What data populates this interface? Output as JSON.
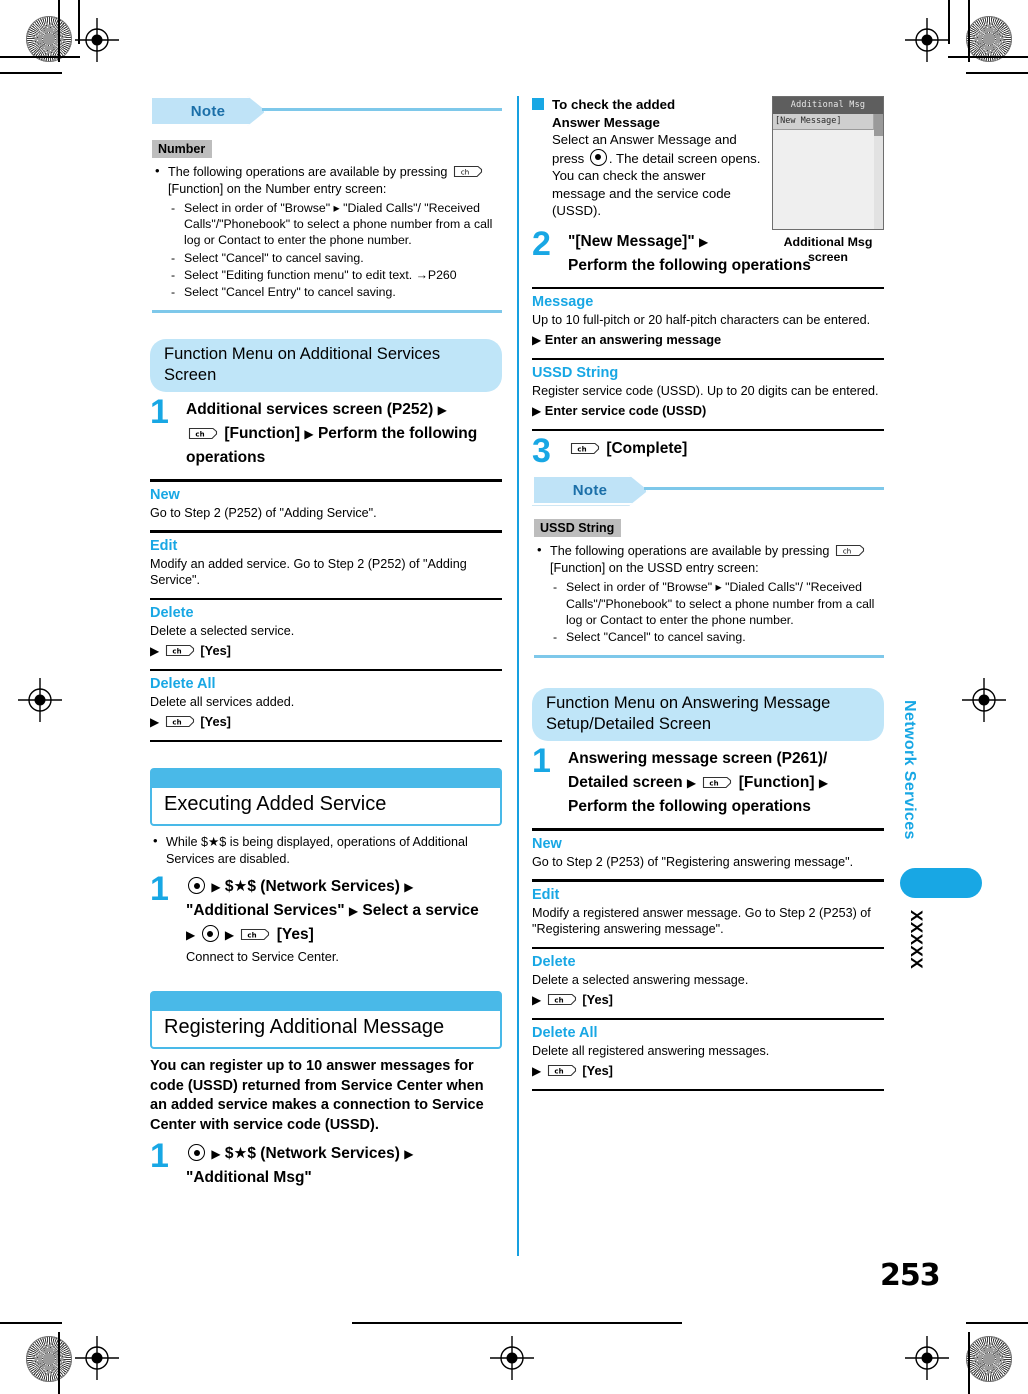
{
  "page": {
    "number": "253",
    "side_tab_label": "Network Services",
    "side_code": "XXXXX"
  },
  "left_column": {
    "note": {
      "banner_label": "Note",
      "tag": "Number",
      "bullet": "The following operations are available by pressing [KEY] [Function] on the Number entry screen:",
      "bullet_before_key": "The following operations are available by pressing",
      "bullet_after_key": "[Function] on the Number entry screen:",
      "dashes": [
        "Select in order of \"Browse\" ▸ \"Dialed Calls\"/ \"Received Calls\"/\"Phonebook\" to select a phone number from a call log or Contact to enter the phone number.",
        "Select \"Cancel\" to cancel saving.",
        "Select \"Editing function menu\" to edit text. →P260",
        "Select \"Cancel Entry\" to cancel saving."
      ]
    },
    "function_menu": {
      "pill_label": "Function Menu on Additional Services Screen",
      "step_number": "1",
      "step_part1": "Additional services screen (P252)",
      "step_part2": "[Function]",
      "step_part3": "Perform the following operations",
      "items": [
        {
          "title": "New",
          "body": "Go to Step 2 (P252) of \"Adding Service\".",
          "operation": ""
        },
        {
          "title": "Edit",
          "body": "Modify an added service. Go to Step 2 (P252) of \"Adding Service\".",
          "operation": ""
        },
        {
          "title": "Delete",
          "body": "Delete a selected service.",
          "operation": "[Yes]"
        },
        {
          "title": "Delete All",
          "body": "Delete all services added.",
          "operation": "[Yes]"
        }
      ]
    },
    "executing_section": {
      "heading": "Executing Added Service",
      "bullet": "While $★$ is being displayed, operations of Additional Services are disabled.",
      "step_number": "1",
      "step_line1": "$★$ (Network Services)",
      "step_line2": "\"Additional Services\"",
      "step_line2b": "Select a service",
      "step_line3": "[Yes]",
      "step_note": "Connect to Service Center."
    },
    "registering_section": {
      "heading": "Registering Additional Message",
      "intro": "You can register up to 10 answer messages for code (USSD) returned from Service Center when an added service makes a connection to Service Center with service code (USSD).",
      "step_number": "1",
      "step_line1": "$★$ (Network Services)",
      "step_line2": "\"Additional Msg\""
    }
  },
  "right_column": {
    "check_block": {
      "subhead_line1": "To check the added",
      "subhead_line2": "Answer Message",
      "body_before_key": "Select an Answer Message and press",
      "body_after_key": ". The detail screen opens.  You can check the answer message and the service code (USSD)."
    },
    "figure": {
      "title_bar": "Additional Msg",
      "row_label": "[New Message]",
      "caption_line1": "Additional Msg",
      "caption_line2": "screen"
    },
    "step2": {
      "number": "2",
      "line1": "\"[New Message]\"",
      "line2": "Perform the following operations"
    },
    "items": [
      {
        "title": "Message",
        "body": "Up to 10 full-pitch or 20 half-pitch characters can be entered.",
        "operation": "Enter an answering message"
      },
      {
        "title": "USSD String",
        "body": "Register service code (USSD). Up to 20 digits can be entered.",
        "operation": "Enter service code (USSD)"
      }
    ],
    "step3": {
      "number": "3",
      "label": "[Complete]"
    },
    "note": {
      "banner_label": "Note",
      "tag": "USSD String",
      "bullet_before_key": "The following operations are available by pressing",
      "bullet_after_key": "[Function] on the USSD entry screen:",
      "dashes": [
        "Select in order of \"Browse\" ▸ \"Dialed Calls\"/ \"Received Calls\"/\"Phonebook\" to select a phone number from a call log or Contact to enter the phone number.",
        "Select \"Cancel\" to cancel saving."
      ]
    },
    "function_menu": {
      "pill_label": "Function Menu on Answering Message Setup/Detailed Screen",
      "step_number": "1",
      "step_line1": "Answering message screen (P261)/",
      "step_line2a": "Detailed screen",
      "step_line2b": "[Function]",
      "step_line3": "Perform the following operations",
      "items": [
        {
          "title": "New",
          "body": "Go to Step 2 (P253) of \"Registering answering message\".",
          "operation": ""
        },
        {
          "title": "Edit",
          "body": "Modify a registered answer message. Go to Step 2 (P253) of \"Registering answering message\".",
          "operation": ""
        },
        {
          "title": "Delete",
          "body": "Delete a selected answering message.",
          "operation": "[Yes]"
        },
        {
          "title": "Delete All",
          "body": "Delete all registered answering messages.",
          "operation": "[Yes]"
        }
      ]
    }
  },
  "icons": {
    "key_glyph": "ch",
    "arrow": "▸",
    "center_key": "center-select-key"
  }
}
